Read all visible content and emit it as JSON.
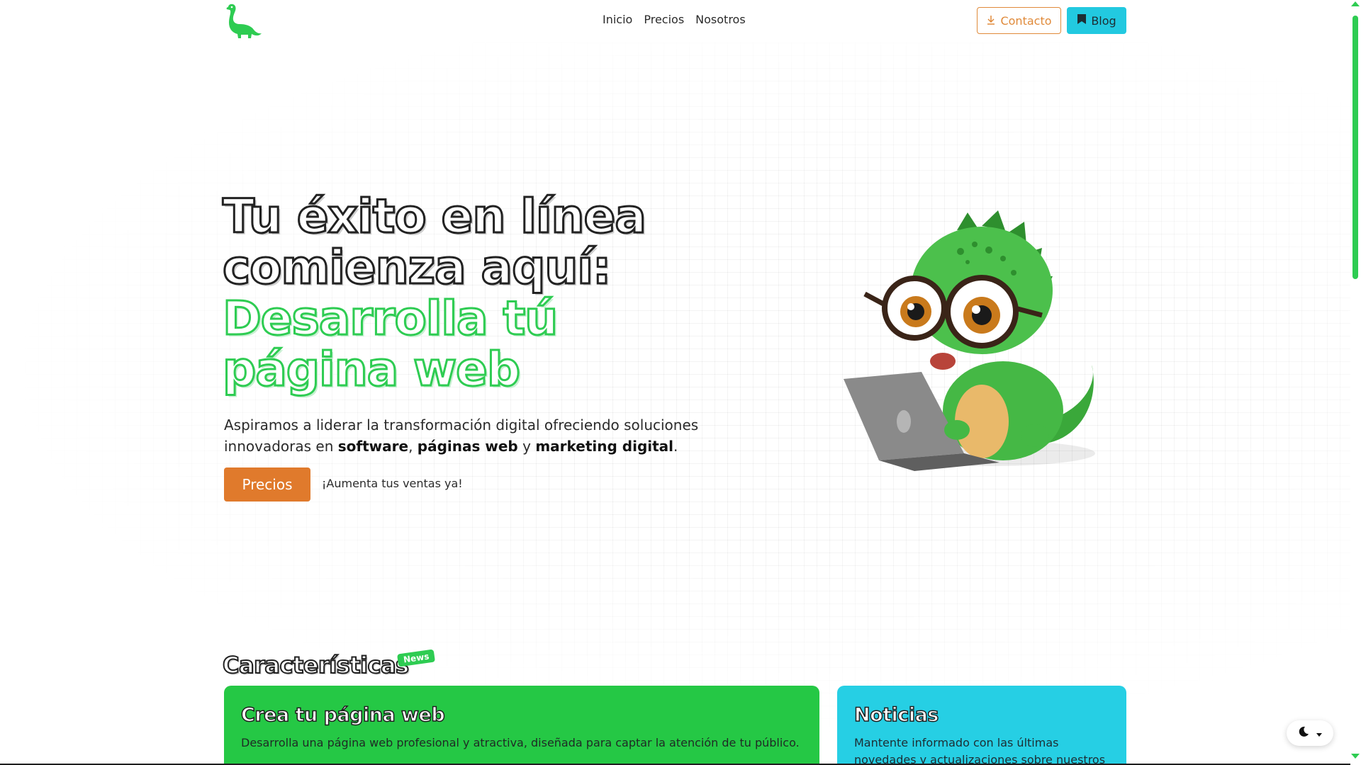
{
  "colors": {
    "brand_green": "#2ecc52",
    "accent_orange": "#e07a2c",
    "accent_cyan": "#22c9e0",
    "card_green": "#25c845",
    "card_cyan": "#26cfe4"
  },
  "nav": {
    "links": [
      {
        "label": "Inicio"
      },
      {
        "label": "Precios"
      },
      {
        "label": "Nosotros"
      }
    ],
    "contacto_label": "Contacto",
    "blog_label": "Blog",
    "logo_icon": "dinosaur-logo-icon",
    "contacto_icon": "download-icon",
    "blog_icon": "bookmark-icon"
  },
  "hero": {
    "title_line1": "Tu éxito en línea",
    "title_line2": "comienza aquí:",
    "title_line3": "Desarrolla tú",
    "title_line4": "página web",
    "desc_prefix": "Aspiramos a liderar la transformación digital ofreciendo soluciones innovadoras en ",
    "desc_bold1": "software",
    "desc_sep1": ", ",
    "desc_bold2": "páginas web",
    "desc_sep2": " y ",
    "desc_bold3": "marketing digital",
    "desc_end": ".",
    "cta_button": "Precios",
    "cta_text": "¡Aumenta tus ventas ya!",
    "illustration_icon": "dinosaur-laptop-illustration"
  },
  "features": {
    "title": "Características",
    "badge": "News",
    "cards": [
      {
        "title": "Crea tu página web",
        "text": "Desarrolla una página web profesional y atractiva, diseñada para captar la atención de tu público."
      },
      {
        "title": "Noticias",
        "text": "Mantente informado con las últimas novedades y actualizaciones sobre nuestros"
      }
    ]
  },
  "theme_toggle": {
    "icon": "moon-icon",
    "dropdown_icon": "caret-down-icon"
  }
}
